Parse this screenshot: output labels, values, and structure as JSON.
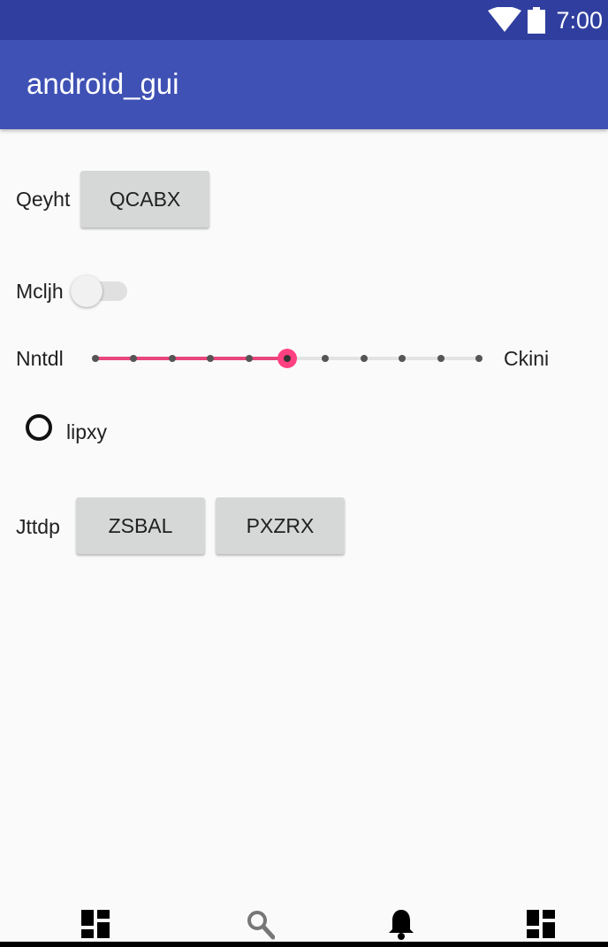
{
  "status_bar": {
    "time": "7:00",
    "icons": [
      "wifi-icon",
      "battery-icon"
    ]
  },
  "app_bar": {
    "title": "android_gui"
  },
  "colors": {
    "primary": "#3f51b5",
    "primary_dark": "#303f9f",
    "accent": "#ff4081"
  },
  "form": {
    "row1": {
      "label": "Qeyht",
      "button": "QCABX"
    },
    "row2": {
      "label": "Mcljh",
      "switch_on": false
    },
    "row3": {
      "label_start": "Nntdl",
      "label_end": "Ckini",
      "seek_value": 5,
      "seek_max": 10
    },
    "row4": {
      "radio_label": "lipxy",
      "radio_checked": false
    },
    "row5": {
      "label": "Jttdp",
      "button1": "ZSBAL",
      "button2": "PXZRX"
    }
  },
  "bottom_nav": {
    "items": [
      "dashboard-icon",
      "search-icon",
      "notifications-icon",
      "dashboard-icon"
    ]
  }
}
